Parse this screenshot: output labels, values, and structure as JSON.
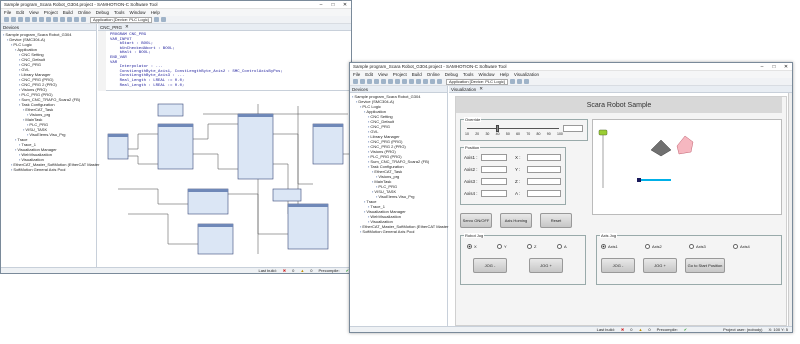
{
  "back": {
    "title": "Sample program_Scara Robot_G304.project - SAMHOTION-C Software Tool",
    "menu": [
      "File",
      "Edit",
      "View",
      "Project",
      "Build",
      "Online",
      "Debug",
      "Tools",
      "Window",
      "Help"
    ],
    "combo": "Application [Device: PLC Logic]",
    "devices_header": "Devices",
    "tree": [
      "Sample program_Scara Robot_G304",
      "Device (SMC304-A)",
      "PLC Logic",
      "Application",
      "CNC Setting",
      "CNC_Default",
      "CNC_PRG",
      "GVL",
      "Library Manager",
      "CNC_PRG (PRG)",
      "CNC_PRG 2 (PRG)",
      "Visions (PRG)",
      "PLC_PRG (PRG)",
      "Sum_CNC_TRAFO_Scara2 (FB)",
      "Task Configuration",
      "EtherCAT_Task",
      "Visions_prg",
      "MainTask",
      "PLC_PRG",
      "VISU_TASK",
      "VisuElems.Visu_Prg",
      "Trace",
      "Trace_1",
      "Visualization Manager",
      "WebVisualization",
      "Visualization",
      "EtherCAT_Master_SoftMotion (EtherCAT Master",
      "SoftMotion General Axis Pool"
    ],
    "tab": "CNC_PRG",
    "code": [
      "PROGRAM CNC_PRG",
      "VAR_INPUT",
      "    bStart : BOOL;",
      "    bUnCheckedAbort : BOOL;",
      "    bHalt : BOOL;",
      "END_VAR",
      "VAR",
      "    Interpolator : ...",
      "    ConstLengthByte_Axis1, ConstLengthByte_Axis2 : SMC_ControlAxisByPos;",
      "    ConstLengthByte_Axis3 : ...",
      "    Real_Length : LREAL := 0.0;",
      "    Real_Length : LREAL := 0.0;"
    ],
    "status": {
      "last_build": "Last build:",
      "errors": "0",
      "warnings": "0",
      "precompile": "Precompile:"
    }
  },
  "front": {
    "title": "Sample program_Scara Robot_G304.project - SAMHOTION-C Software Tool",
    "menu": [
      "File",
      "Edit",
      "View",
      "Project",
      "Build",
      "Online",
      "Debug",
      "Tools",
      "Window",
      "Help",
      "Visualization"
    ],
    "combo": "Application [Device: PLC Logic]",
    "devices_header": "Devices",
    "tree": [
      "Sample program_Scara Robot_G304",
      "Device (SMC304-A)",
      "PLC Logic",
      "Application",
      "CNC Setting",
      "CNC_Default",
      "CNC_PRG",
      "GVL",
      "Library Manager",
      "CNC_PRG (PRG)",
      "CNC_PRG 2 (PRG)",
      "Visions (PRG)",
      "PLC_PRG (PRG)",
      "Sum_CNC_TRAFO_Scara2 (FB)",
      "Task Configuration",
      "EtherCAT_Task",
      "Visions_prg",
      "MainTask",
      "PLC_PRG",
      "VISU_TASK",
      "VisuElems.Visu_Prg",
      "Trace",
      "Trace_1",
      "Visualization Manager",
      "WebVisualization",
      "Visualization",
      "EtherCAT_Master_SoftMotion (EtherCAT Master",
      "SoftMotion General Axis Pool"
    ],
    "tab": "Visualization",
    "visu": {
      "title": "Scara Robot Sample",
      "override_label": "Override",
      "slider_ticks": [
        "10",
        "20",
        "30",
        "40",
        "50",
        "60",
        "70",
        "80",
        "90",
        "100"
      ],
      "override_value": 40,
      "position_label": "Position",
      "axis_labels": [
        "Axis1 :",
        "Axis2 :",
        "Axis3 :",
        "Axis4 :"
      ],
      "coord_labels": [
        "X :",
        "Y :",
        "Z :",
        "A :"
      ],
      "buttons": {
        "servo": "Servo ON/OFF",
        "homing": "Axis Homing",
        "reset": "Reset"
      },
      "robot_jog": {
        "label": "Robot Jog",
        "radios": [
          "X",
          "Y",
          "Z",
          "A"
        ],
        "selected": 0,
        "jog_minus": "JOG -",
        "jog_plus": "JOG +"
      },
      "axis_jog": {
        "label": "Axis Jog",
        "radios": [
          "Axis1",
          "Axis2",
          "Axis3",
          "Axis4"
        ],
        "selected": 0,
        "jog_minus": "JOG -",
        "jog_plus": "JOG +",
        "start_pos": "Go to Start Position"
      }
    },
    "status": {
      "last_build": "Last build:",
      "errors": "0",
      "warnings": "0",
      "precompile": "Precompile:",
      "project_user": "Project user: (nobody)",
      "zoom": "X: 100 Y: 5"
    }
  },
  "colors": {
    "accent": "#6f88b8",
    "frame": "#7a8a9a",
    "robot_arm": "#00b0e8",
    "robot_base": "#707070",
    "target": "#f6b7c0",
    "status_green": "#2a9a2a",
    "status_red": "#d02020"
  }
}
